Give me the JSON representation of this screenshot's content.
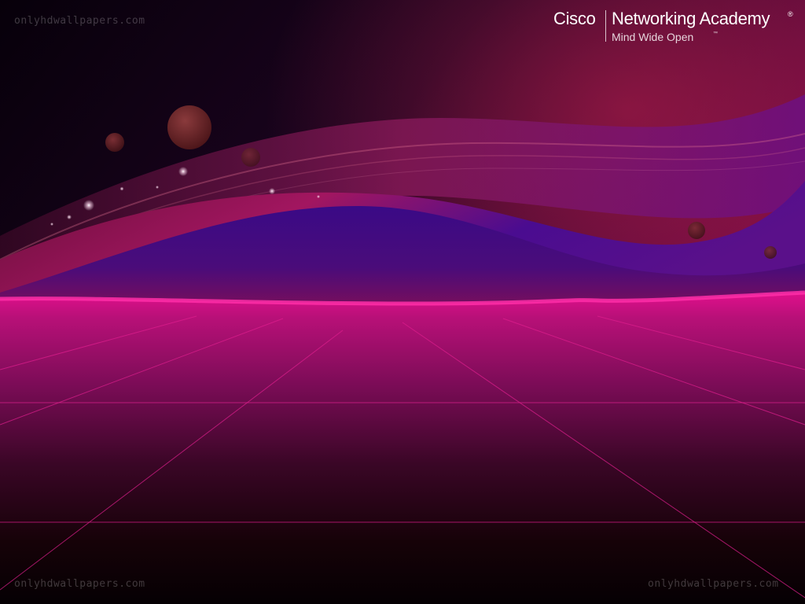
{
  "logo": {
    "brand": "Cisco",
    "title": "Networking Academy",
    "registered_mark": "®",
    "tagline": "Mind Wide Open",
    "trademark": "™"
  },
  "watermark": {
    "top_left": "onlyhdwallpapers.com",
    "bottom_left": "onlyhdwallpapers.com",
    "bottom_right": "onlyhdwallpapers.com"
  },
  "colors": {
    "sky_dark": "#0a0008",
    "wave_purple": "#3c0a8a",
    "wave_magenta": "#b01258",
    "horizon_pink": "#e8108a",
    "floor_magenta": "#a01070",
    "grid_line": "#e0208e"
  }
}
